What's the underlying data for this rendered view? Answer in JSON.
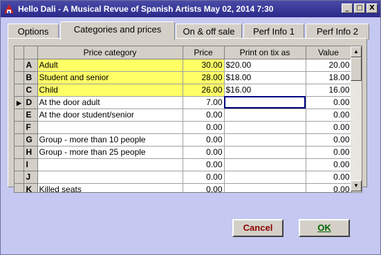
{
  "window": {
    "title": "Hello Dali - A Musical Revue of Spanish Artists May 02, 2014 7:30",
    "minimize": "_",
    "maximize": "□",
    "close": "X"
  },
  "tabs": [
    {
      "label": "Options"
    },
    {
      "label": "Categories and prices"
    },
    {
      "label": "On & off sale"
    },
    {
      "label": "Perf Info 1"
    },
    {
      "label": "Perf Info 2"
    }
  ],
  "table": {
    "headers": [
      "Price category",
      "Price",
      "Print on tix as",
      "Value"
    ],
    "rows": [
      {
        "key": "A",
        "category": "Adult",
        "price": "30.00",
        "print": "$20.00",
        "value": "20.00"
      },
      {
        "key": "B",
        "category": "Student and senior",
        "price": "28.00",
        "print": "$18.00",
        "value": "18.00"
      },
      {
        "key": "C",
        "category": "Child",
        "price": "26.00",
        "print": "$16.00",
        "value": "16.00"
      },
      {
        "key": "D",
        "category": "At the door adult",
        "price": "7.00",
        "print": "",
        "value": "0.00"
      },
      {
        "key": "E",
        "category": "At the door student/senior",
        "price": "0.00",
        "print": "",
        "value": "0.00"
      },
      {
        "key": "F",
        "category": "",
        "price": "0.00",
        "print": "",
        "value": "0.00"
      },
      {
        "key": "G",
        "category": "Group - more than 10 people",
        "price": "0.00",
        "print": "",
        "value": "0.00"
      },
      {
        "key": "H",
        "category": "Group - more than 25 people",
        "price": "0.00",
        "print": "",
        "value": "0.00"
      },
      {
        "key": "I",
        "category": "",
        "price": "0.00",
        "print": "",
        "value": "0.00"
      },
      {
        "key": "J",
        "category": "",
        "price": "0.00",
        "print": "",
        "value": "0.00"
      },
      {
        "key": "K",
        "category": "Killed seats",
        "price": "0.00",
        "print": "",
        "value": "0.00"
      }
    ]
  },
  "buttons": {
    "cancel": "Cancel",
    "ok": "OK"
  },
  "colors": {
    "highlight": "#ffff66",
    "cancel_text": "#8b0000",
    "ok_text": "#006400",
    "title_bar": "#2a2a8a",
    "background": "#c5c8f0"
  }
}
